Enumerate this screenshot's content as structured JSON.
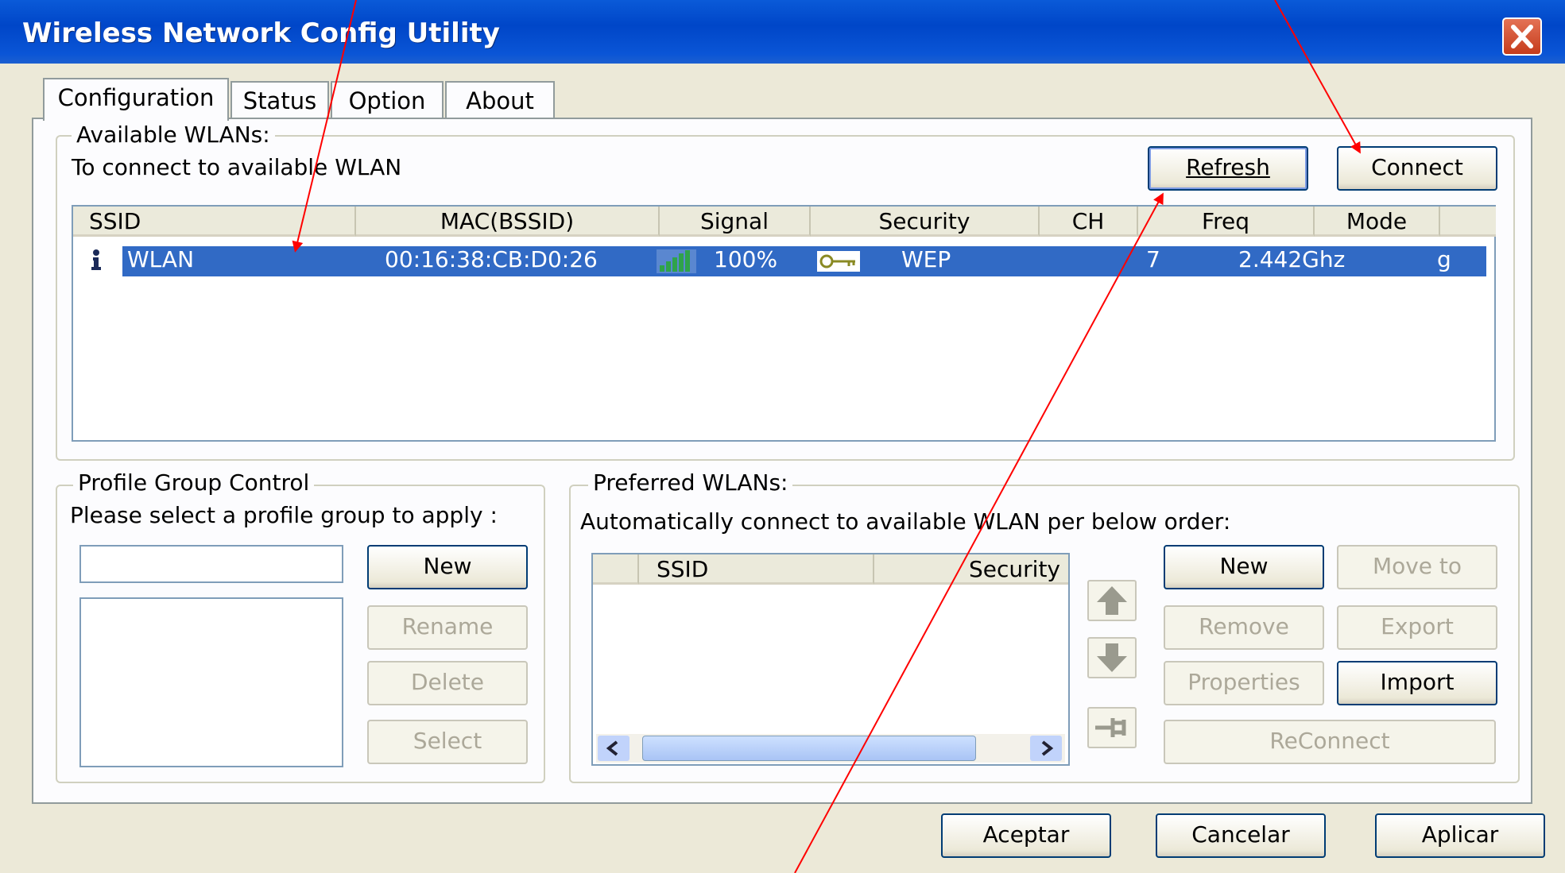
{
  "window": {
    "title": "Wireless Network Config Utility"
  },
  "tabs": [
    "Configuration",
    "Status",
    "Option",
    "About"
  ],
  "available": {
    "legend": "Available WLANs:",
    "instruction": "To connect to available WLAN",
    "refresh_label": "Refresh",
    "connect_label": "Connect",
    "columns": [
      "SSID",
      "MAC(BSSID)",
      "Signal",
      "Security",
      "CH",
      "Freq",
      "Mode"
    ],
    "row": {
      "ssid": "WLAN",
      "mac": "00:16:38:CB:D0:26",
      "signal": "100%",
      "security": "WEP",
      "ch": "7",
      "freq": "2.442Ghz",
      "mode": "g"
    }
  },
  "profile": {
    "legend": "Profile Group Control",
    "instruction": "Please select a profile group to apply :",
    "input_value": "",
    "buttons": [
      "New",
      "Rename",
      "Delete",
      "Select"
    ]
  },
  "preferred": {
    "legend": "Preferred WLANs:",
    "instruction": "Automatically connect to available WLAN per below order:",
    "columns": [
      "SSID",
      "Security"
    ],
    "buttons": [
      "New",
      "Move to",
      "Remove",
      "Export",
      "Properties",
      "Import",
      "ReConnect"
    ]
  },
  "footer": {
    "ok": "Aceptar",
    "cancel": "Cancelar",
    "apply": "Aplicar"
  },
  "colors": {
    "title_bar": "#0046c8",
    "selection": "#316ac5",
    "annotation_arrow": "#ff0000"
  }
}
